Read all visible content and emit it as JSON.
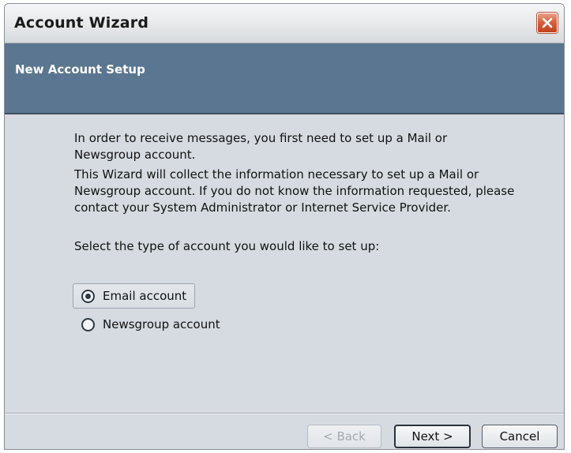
{
  "window": {
    "title": "Account Wizard",
    "close_icon": "close-x-icon"
  },
  "banner": {
    "title": "New Account Setup"
  },
  "content": {
    "intro": "In order to receive messages, you first need to set up a Mail or Newsgroup account.",
    "info": "This Wizard will collect the information necessary to set up a Mail or Newsgroup account. If you do not know the information requested, please contact your System Administrator or Internet Service Provider.",
    "prompt": "Select the type of account you would like to set up:",
    "options": [
      {
        "label": "Email account",
        "selected": true
      },
      {
        "label": "Newsgroup account",
        "selected": false
      }
    ]
  },
  "buttons": {
    "back": "< Back",
    "back_enabled": false,
    "next": "Next >",
    "cancel": "Cancel"
  },
  "colors": {
    "banner": "#5b7690",
    "dialog_bg": "#d6dbe1",
    "close_button": "#d9633f"
  }
}
